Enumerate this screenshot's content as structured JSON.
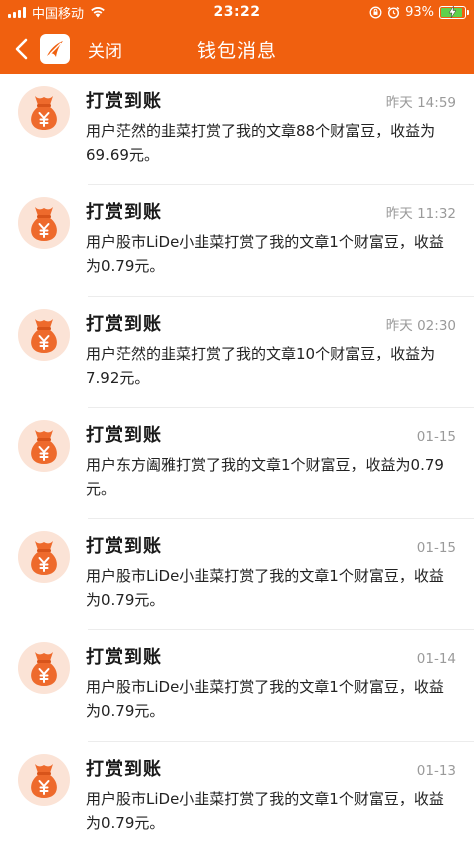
{
  "status": {
    "carrier": "中国移动",
    "time": "23:22",
    "battery": "93%",
    "battery_level": 0.93
  },
  "nav": {
    "close_label": "关闭",
    "title": "钱包消息"
  },
  "messages": [
    {
      "title": "打赏到账",
      "time": "昨天 14:59",
      "text": "用户茫然的韭菜打赏了我的文章88个财富豆，收益为69.69元。"
    },
    {
      "title": "打赏到账",
      "time": "昨天 11:32",
      "text": "用户股市LiDe小韭菜打赏了我的文章1个财富豆，收益为0.79元。"
    },
    {
      "title": "打赏到账",
      "time": "昨天 02:30",
      "text": "用户茫然的韭菜打赏了我的文章10个财富豆，收益为7.92元。"
    },
    {
      "title": "打赏到账",
      "time": "01-15",
      "text": "用户东方阖雅打赏了我的文章1个财富豆，收益为0.79元。"
    },
    {
      "title": "打赏到账",
      "time": "01-15",
      "text": "用户股市LiDe小韭菜打赏了我的文章1个财富豆，收益为0.79元。"
    },
    {
      "title": "打赏到账",
      "time": "01-14",
      "text": "用户股市LiDe小韭菜打赏了我的文章1个财富豆，收益为0.79元。"
    },
    {
      "title": "打赏到账",
      "time": "01-13",
      "text": "用户股市LiDe小韭菜打赏了我的文章1个财富豆，收益为0.79元。"
    }
  ],
  "colors": {
    "brand": "#f0600f",
    "avatar_bag": "#ee6a2c",
    "battery_fill": "#5fd04c"
  },
  "icons": {
    "back": "chevron-left-icon",
    "logo": "app-logo-icon",
    "avatar": "money-bag-icon"
  }
}
